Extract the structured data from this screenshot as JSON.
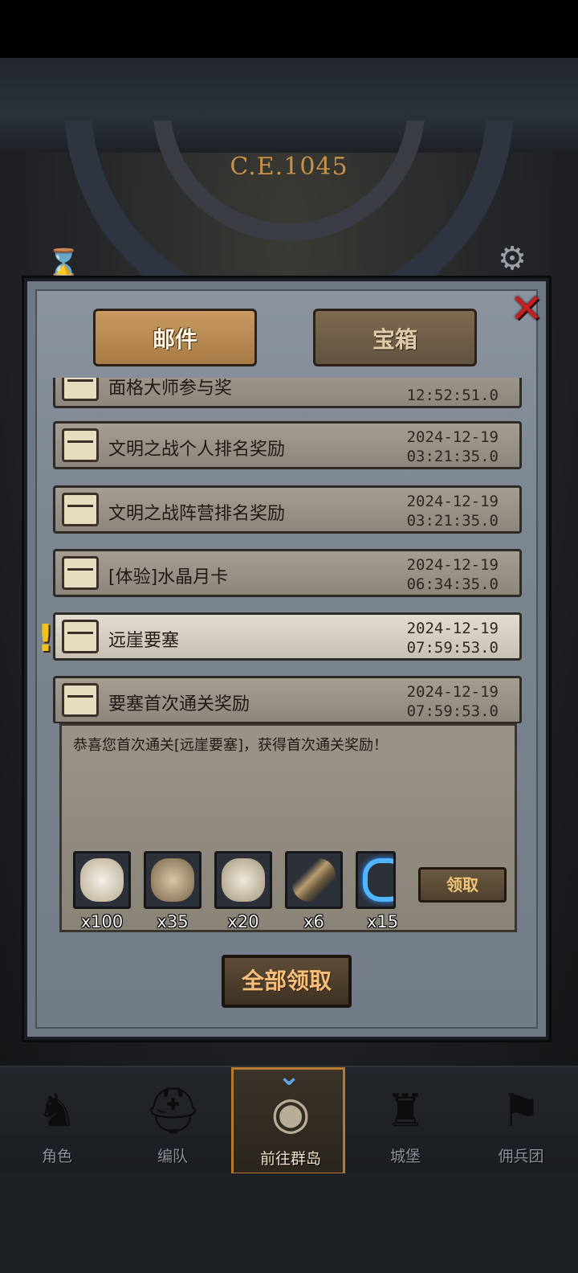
{
  "background": {
    "era_label": "C.E.1045",
    "dial_current": "5"
  },
  "modal": {
    "tabs": [
      {
        "label": "邮件",
        "active": true
      },
      {
        "label": "宝箱",
        "active": false
      }
    ],
    "mail_list": [
      {
        "title": "面格大师参与奖",
        "date": "",
        "time": "12:52:51.0"
      },
      {
        "title": "文明之战个人排名奖励",
        "date": "2024-12-19",
        "time": "03:21:35.0"
      },
      {
        "title": "文明之战阵营排名奖励",
        "date": "2024-12-19",
        "time": "03:21:35.0"
      },
      {
        "title": "[体验]水晶月卡",
        "date": "2024-12-19",
        "time": "06:34:35.0"
      },
      {
        "title": "远崖要塞",
        "date": "2024-12-19",
        "time": "07:59:53.0",
        "unread": true
      },
      {
        "title": "要塞首次通关奖励",
        "date": "2024-12-19",
        "time": "07:59:53.0"
      }
    ],
    "alert_mark": "!",
    "open_mail": {
      "body": "恭喜您首次通关[远崖要塞]，获得首次通关奖励！",
      "rewards": [
        {
          "icon": "fur-pelt-icon",
          "qty": "x100"
        },
        {
          "icon": "claw-icon",
          "qty": "x35"
        },
        {
          "icon": "feather-hide-icon",
          "qty": "x20"
        },
        {
          "icon": "horn-icon",
          "qty": "x6"
        },
        {
          "icon": "blue-energy-icon",
          "qty": "x15"
        }
      ],
      "claim_label": "领取"
    },
    "claim_all_label": "全部领取",
    "close_glyph": "✕"
  },
  "nav": [
    {
      "label": "角色",
      "icon": "knight-icon"
    },
    {
      "label": "编队",
      "icon": "helmet-icon"
    },
    {
      "label": "前往群岛",
      "icon": "globe-icon",
      "active": true
    },
    {
      "label": "城堡",
      "icon": "castle-icon"
    },
    {
      "label": "佣兵团",
      "icon": "banner-icon"
    }
  ],
  "colors": {
    "accent": "#b87a2a",
    "close_red": "#c81e1e",
    "alert_yellow": "#f2c21c"
  }
}
